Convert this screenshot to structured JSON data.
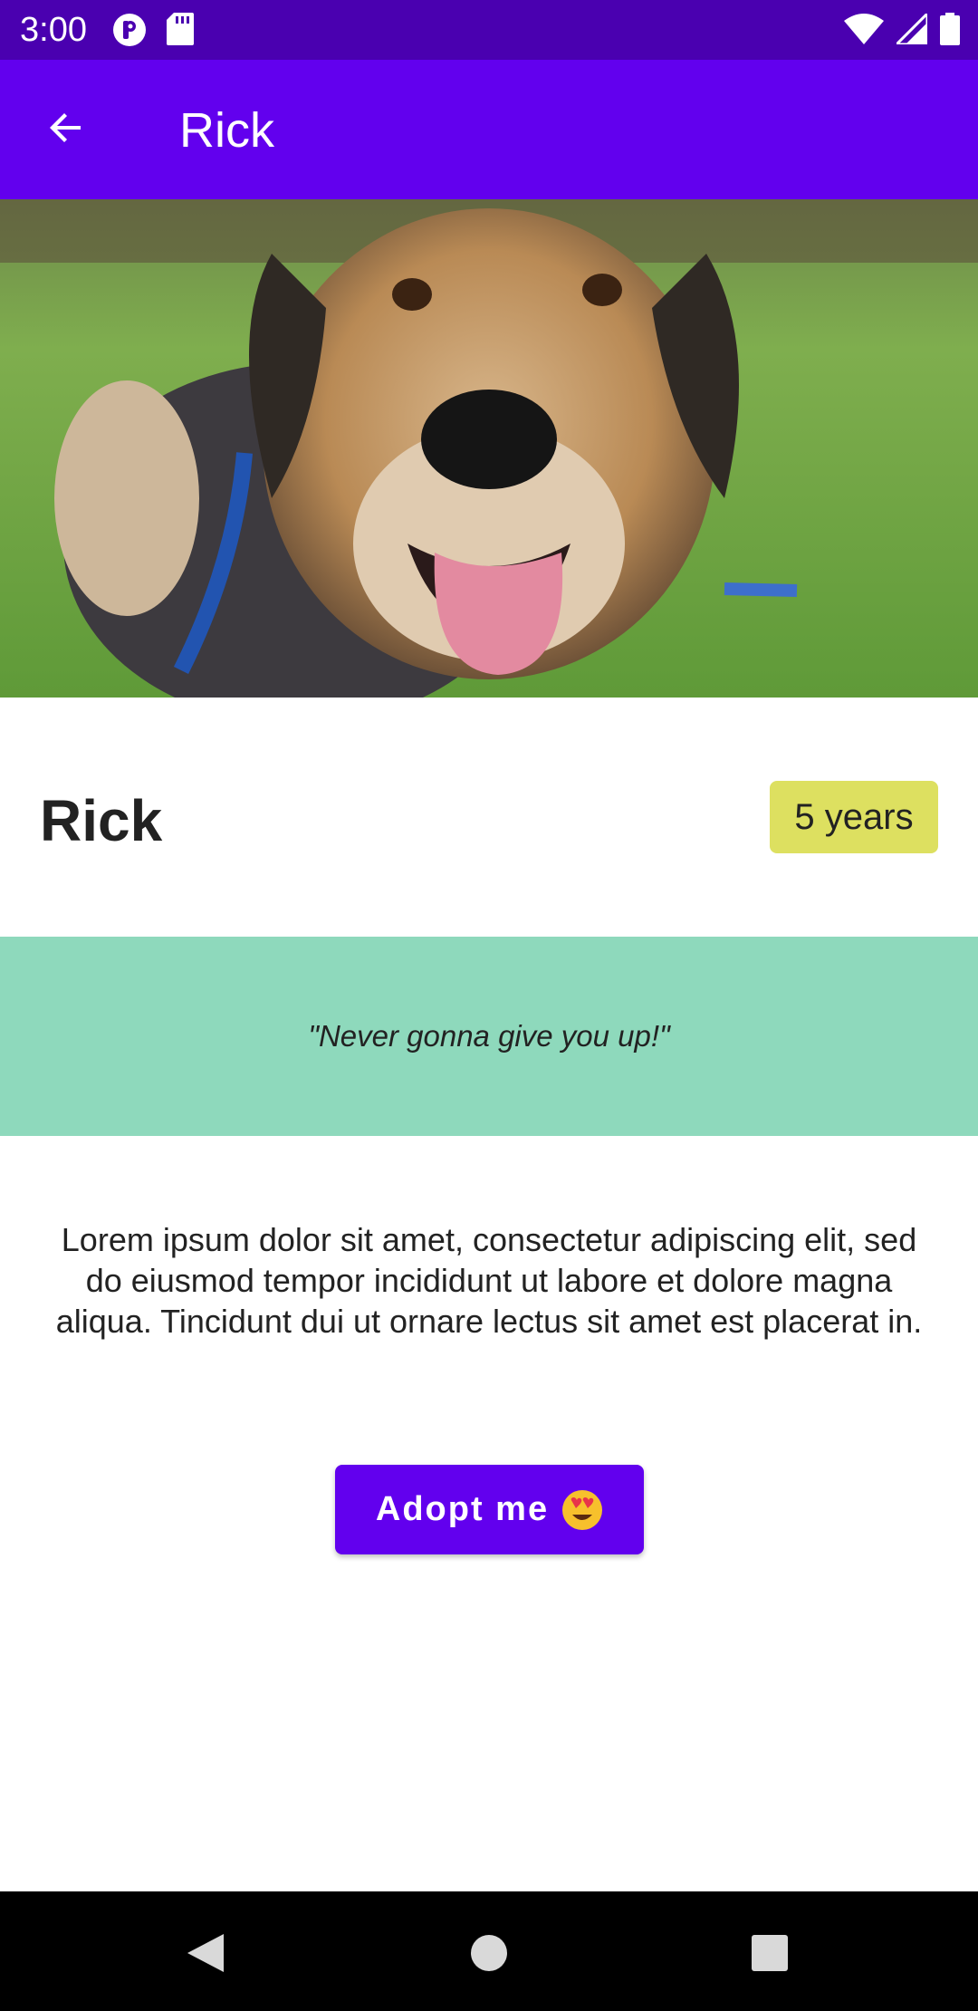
{
  "status_bar": {
    "time": "3:00",
    "left_icons": [
      "notification-p-icon",
      "sd-card-icon"
    ],
    "right_icons": [
      "wifi-icon",
      "signal-icon",
      "battery-icon"
    ]
  },
  "app_bar": {
    "title": "Rick",
    "back_icon": "arrow-back-icon"
  },
  "pet": {
    "name": "Rick",
    "age": "5 years",
    "quote": "\"Never gonna give you up!\"",
    "description": "Lorem ipsum dolor sit amet, consectetur adipiscing elit, sed do eiusmod tempor incididunt ut labore et dolore magna aliqua. Tincidunt dui ut ornare lectus sit amet est placerat in."
  },
  "actions": {
    "adopt_label": "Adopt me",
    "adopt_emoji_icon": "heart-eyes-emoji-icon"
  },
  "nav_bar": {
    "icons": [
      "nav-back-icon",
      "nav-home-icon",
      "nav-recents-icon"
    ]
  },
  "colors": {
    "status_bar": "#4a00b0",
    "app_bar": "#6200ee",
    "age_chip": "#dde060",
    "quote_band": "#8ed9bc",
    "button": "#6200ee"
  }
}
